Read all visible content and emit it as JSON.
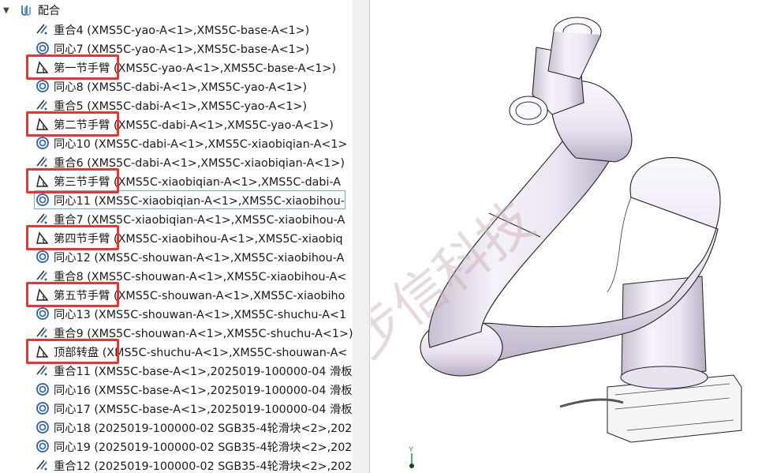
{
  "tree": {
    "root_label": "配合",
    "rows": [
      {
        "icon": "coincident",
        "label": "重合4 (XMS5C-yao-A<1>,XMS5C-base-A<1>)"
      },
      {
        "icon": "concentric",
        "label": "同心7 (XMS5C-yao-A<1>,XMS5C-base-A<1>)"
      },
      {
        "icon": "angle",
        "label": "第一节手臂 (XMS5C-yao-A<1>,XMS5C-base-A<1>)"
      },
      {
        "icon": "concentric",
        "label": "同心8 (XMS5C-dabi-A<1>,XMS5C-yao-A<1>)"
      },
      {
        "icon": "coincident",
        "label": "重合5 (XMS5C-dabi-A<1>,XMS5C-yao-A<1>)"
      },
      {
        "icon": "angle",
        "label": "第二节手臂 (XMS5C-dabi-A<1>,XMS5C-yao-A<1>)"
      },
      {
        "icon": "concentric",
        "label": "同心10 (XMS5C-dabi-A<1>,XMS5C-xiaobiqian-A<1>"
      },
      {
        "icon": "coincident",
        "label": "重合6 (XMS5C-dabi-A<1>,XMS5C-xiaobiqian-A<1>)"
      },
      {
        "icon": "angle",
        "label": "第三节手臂 (XMS5C-xiaobiqian-A<1>,XMS5C-dabi-A"
      },
      {
        "icon": "concentric",
        "label": "同心11 (XMS5C-xiaobiqian-A<1>,XMS5C-xiaobihou-"
      },
      {
        "icon": "coincident",
        "label": "重合7 (XMS5C-xiaobiqian-A<1>,XMS5C-xiaobihou-A"
      },
      {
        "icon": "angle",
        "label": "第四节手臂 (XMS5C-xiaobihou-A<1>,XMS5C-xiaobiq"
      },
      {
        "icon": "concentric",
        "label": "同心12 (XMS5C-shouwan-A<1>,XMS5C-xiaobihou-A"
      },
      {
        "icon": "coincident",
        "label": "重合8 (XMS5C-shouwan-A<1>,XMS5C-xiaobihou-A<"
      },
      {
        "icon": "angle",
        "label": "第五节手臂 (XMS5C-shouwan-A<1>,XMS5C-xiaobiho"
      },
      {
        "icon": "concentric",
        "label": "同心13 (XMS5C-shouwan-A<1>,XMS5C-shuchu-A<1"
      },
      {
        "icon": "coincident",
        "label": "重合9 (XMS5C-shouwan-A<1>,XMS5C-shuchu-A<1>)"
      },
      {
        "icon": "angle",
        "label": "顶部转盘 (XMS5C-shuchu-A<1>,XMS5C-shouwan-A<"
      },
      {
        "icon": "coincident",
        "label": "重合11 (XMS5C-base-A<1>,2025019-100000-04 滑板"
      },
      {
        "icon": "concentric",
        "label": "同心16 (XMS5C-base-A<1>,2025019-100000-04 滑板"
      },
      {
        "icon": "concentric",
        "label": "同心17 (XMS5C-base-A<1>,2025019-100000-04 滑板"
      },
      {
        "icon": "concentric",
        "label": "同心18 (2025019-100000-02 SGB35-4轮滑块<2>,202"
      },
      {
        "icon": "concentric",
        "label": "同心19 (2025019-100000-02 SGB35-4轮滑块<2>,202"
      },
      {
        "icon": "coincident",
        "label": "重合12 (2025019-100000-02 SGB35-4轮滑块<2>,202"
      }
    ]
  },
  "viewport": {
    "watermark": "步信科技",
    "triad_y_label": "Y"
  },
  "colors": {
    "highlight_box": "#e8362e",
    "robot_body": "#f3eef8",
    "icon_blue": "#2a5fb0"
  }
}
